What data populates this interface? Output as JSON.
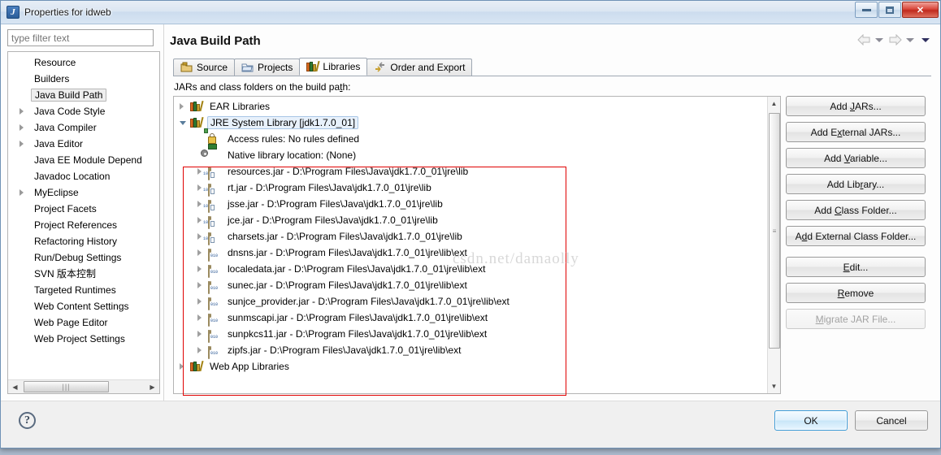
{
  "window": {
    "title": "Properties for idweb",
    "icon": "eclipse-icon",
    "minimize_label": "Minimize",
    "maximize_label": "Maximize",
    "close_label": "Close"
  },
  "filter": {
    "placeholder": "type filter text",
    "value": ""
  },
  "sidebar": {
    "items": [
      {
        "label": "Resource",
        "expandable": false,
        "selected": false
      },
      {
        "label": "Builders",
        "expandable": false,
        "selected": false
      },
      {
        "label": "Java Build Path",
        "expandable": false,
        "selected": true
      },
      {
        "label": "Java Code Style",
        "expandable": true,
        "selected": false
      },
      {
        "label": "Java Compiler",
        "expandable": true,
        "selected": false
      },
      {
        "label": "Java Editor",
        "expandable": true,
        "selected": false
      },
      {
        "label": "Java EE Module Depend",
        "expandable": false,
        "selected": false
      },
      {
        "label": "Javadoc Location",
        "expandable": false,
        "selected": false
      },
      {
        "label": "MyEclipse",
        "expandable": true,
        "selected": false
      },
      {
        "label": "Project Facets",
        "expandable": false,
        "selected": false
      },
      {
        "label": "Project References",
        "expandable": false,
        "selected": false
      },
      {
        "label": "Refactoring History",
        "expandable": false,
        "selected": false
      },
      {
        "label": "Run/Debug Settings",
        "expandable": false,
        "selected": false
      },
      {
        "label": "SVN 版本控制",
        "expandable": false,
        "selected": false
      },
      {
        "label": "Targeted Runtimes",
        "expandable": false,
        "selected": false
      },
      {
        "label": "Web Content Settings",
        "expandable": false,
        "selected": false
      },
      {
        "label": "Web Page Editor",
        "expandable": false,
        "selected": false
      },
      {
        "label": "Web Project Settings",
        "expandable": false,
        "selected": false
      }
    ]
  },
  "page": {
    "title": "Java Build Path",
    "nav_back_icon": "arrow-left-icon",
    "nav_back_menu_icon": "chevron-down-icon",
    "nav_forward_icon": "arrow-right-icon",
    "nav_forward_menu_icon": "chevron-down-icon",
    "nav_menu_icon": "chevron-down-icon"
  },
  "tabs": [
    {
      "label": "Source",
      "icon": "source-folder-icon",
      "active": false
    },
    {
      "label": "Projects",
      "icon": "project-folder-icon",
      "active": false
    },
    {
      "label": "Libraries",
      "icon": "libraries-icon",
      "active": true
    },
    {
      "label": "Order and Export",
      "icon": "order-export-icon",
      "active": false
    }
  ],
  "main": {
    "list_label": "JARs and class folders on the build path:",
    "tree": [
      {
        "level": 0,
        "label": "EAR Libraries",
        "icon": "library-icon",
        "state": "collapsed",
        "selected": false
      },
      {
        "level": 0,
        "label": "JRE System Library [jdk1.7.0_01]",
        "icon": "library-icon",
        "state": "expanded",
        "selected": true
      },
      {
        "level": 1,
        "label": "Access rules: No rules defined",
        "icon": "access-rules-icon",
        "state": "leaf",
        "selected": false
      },
      {
        "level": 1,
        "label": "Native library location: (None)",
        "icon": "native-library-icon",
        "state": "leaf",
        "selected": false
      },
      {
        "level": 1,
        "label": "resources.jar - D:\\Program Files\\Java\\jdk1.7.0_01\\jre\\lib",
        "icon": "jar-icon",
        "state": "collapsed",
        "selected": false
      },
      {
        "level": 1,
        "label": "rt.jar - D:\\Program Files\\Java\\jdk1.7.0_01\\jre\\lib",
        "icon": "jar-icon",
        "state": "collapsed",
        "selected": false
      },
      {
        "level": 1,
        "label": "jsse.jar - D:\\Program Files\\Java\\jdk1.7.0_01\\jre\\lib",
        "icon": "jar-icon",
        "state": "collapsed",
        "selected": false
      },
      {
        "level": 1,
        "label": "jce.jar - D:\\Program Files\\Java\\jdk1.7.0_01\\jre\\lib",
        "icon": "jar-icon",
        "state": "collapsed",
        "selected": false
      },
      {
        "level": 1,
        "label": "charsets.jar - D:\\Program Files\\Java\\jdk1.7.0_01\\jre\\lib",
        "icon": "jar-icon",
        "state": "collapsed",
        "selected": false
      },
      {
        "level": 1,
        "label": "dnsns.jar - D:\\Program Files\\Java\\jdk1.7.0_01\\jre\\lib\\ext",
        "icon": "jar-ext-icon",
        "state": "collapsed",
        "selected": false
      },
      {
        "level": 1,
        "label": "localedata.jar - D:\\Program Files\\Java\\jdk1.7.0_01\\jre\\lib\\ext",
        "icon": "jar-ext-icon",
        "state": "collapsed",
        "selected": false
      },
      {
        "level": 1,
        "label": "sunec.jar - D:\\Program Files\\Java\\jdk1.7.0_01\\jre\\lib\\ext",
        "icon": "jar-ext-icon",
        "state": "collapsed",
        "selected": false
      },
      {
        "level": 1,
        "label": "sunjce_provider.jar - D:\\Program Files\\Java\\jdk1.7.0_01\\jre\\lib\\ext",
        "icon": "jar-ext-icon",
        "state": "collapsed",
        "selected": false
      },
      {
        "level": 1,
        "label": "sunmscapi.jar - D:\\Program Files\\Java\\jdk1.7.0_01\\jre\\lib\\ext",
        "icon": "jar-ext-icon",
        "state": "collapsed",
        "selected": false
      },
      {
        "level": 1,
        "label": "sunpkcs11.jar - D:\\Program Files\\Java\\jdk1.7.0_01\\jre\\lib\\ext",
        "icon": "jar-ext-icon",
        "state": "collapsed",
        "selected": false
      },
      {
        "level": 1,
        "label": "zipfs.jar - D:\\Program Files\\Java\\jdk1.7.0_01\\jre\\lib\\ext",
        "icon": "jar-ext-icon",
        "state": "collapsed",
        "selected": false
      },
      {
        "level": 0,
        "label": "Web App Libraries",
        "icon": "library-icon",
        "state": "collapsed",
        "selected": false
      }
    ]
  },
  "side_buttons": [
    {
      "label": "Add JARs...",
      "mnemonic": "J",
      "disabled": false
    },
    {
      "label": "Add External JARs...",
      "mnemonic": "x",
      "disabled": false
    },
    {
      "label": "Add Variable...",
      "mnemonic": "V",
      "disabled": false
    },
    {
      "label": "Add Library...",
      "mnemonic": "r",
      "disabled": false
    },
    {
      "label": "Add Class Folder...",
      "mnemonic": "C",
      "disabled": false
    },
    {
      "label": "Add External Class Folder...",
      "mnemonic": "d",
      "disabled": false
    },
    {
      "label": "Edit...",
      "mnemonic": "E",
      "disabled": false
    },
    {
      "label": "Remove",
      "mnemonic": "R",
      "disabled": false
    },
    {
      "label": "Migrate JAR File...",
      "mnemonic": "M",
      "disabled": true
    }
  ],
  "footer": {
    "help_icon": "help-question-icon",
    "ok_label": "OK",
    "cancel_label": "Cancel"
  },
  "annotation": {
    "watermark": "csdn.net/damaolly",
    "highlight_color": "#e00000"
  }
}
